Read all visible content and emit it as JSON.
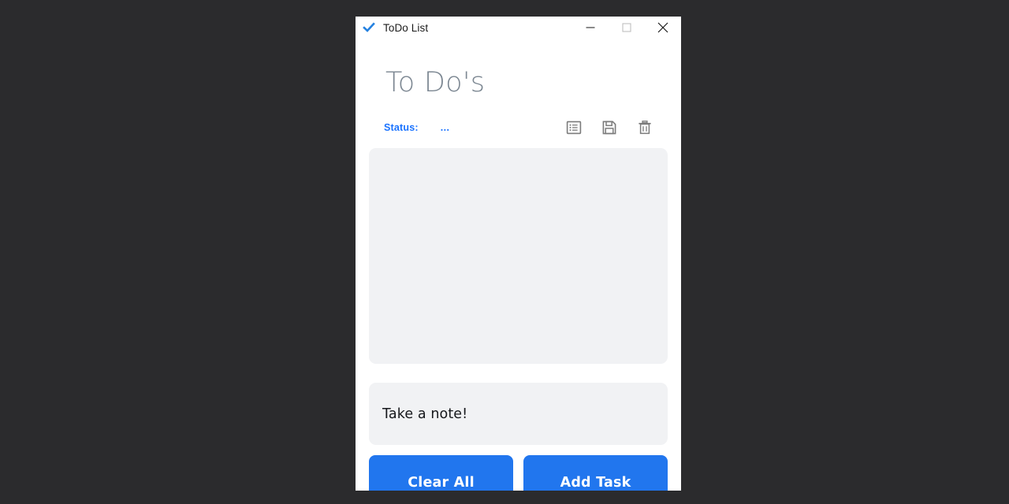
{
  "window": {
    "title": "ToDo List",
    "app_icon": "checkmark-icon",
    "controls": {
      "minimize": "minimize-icon",
      "maximize": "maximize-icon",
      "close": "close-icon"
    }
  },
  "page": {
    "heading": "To Do's"
  },
  "status": {
    "label": "Status:",
    "value": "..."
  },
  "toolbar": {
    "items": [
      {
        "name": "list-icon",
        "title": "List"
      },
      {
        "name": "save-icon",
        "title": "Save"
      },
      {
        "name": "trash-icon",
        "title": "Delete"
      }
    ]
  },
  "task_list": {
    "items": [],
    "empty_text": ""
  },
  "note": {
    "value": "",
    "placeholder": "Take a note!"
  },
  "buttons": {
    "clear_all": "Clear All",
    "add_task": "Add Task"
  },
  "colors": {
    "accent": "#2176ee",
    "status_blue": "#1a73ff",
    "heading_gray": "#7c8792",
    "panel_gray": "#f1f2f4",
    "desktop_background": "#2b2b2d"
  }
}
